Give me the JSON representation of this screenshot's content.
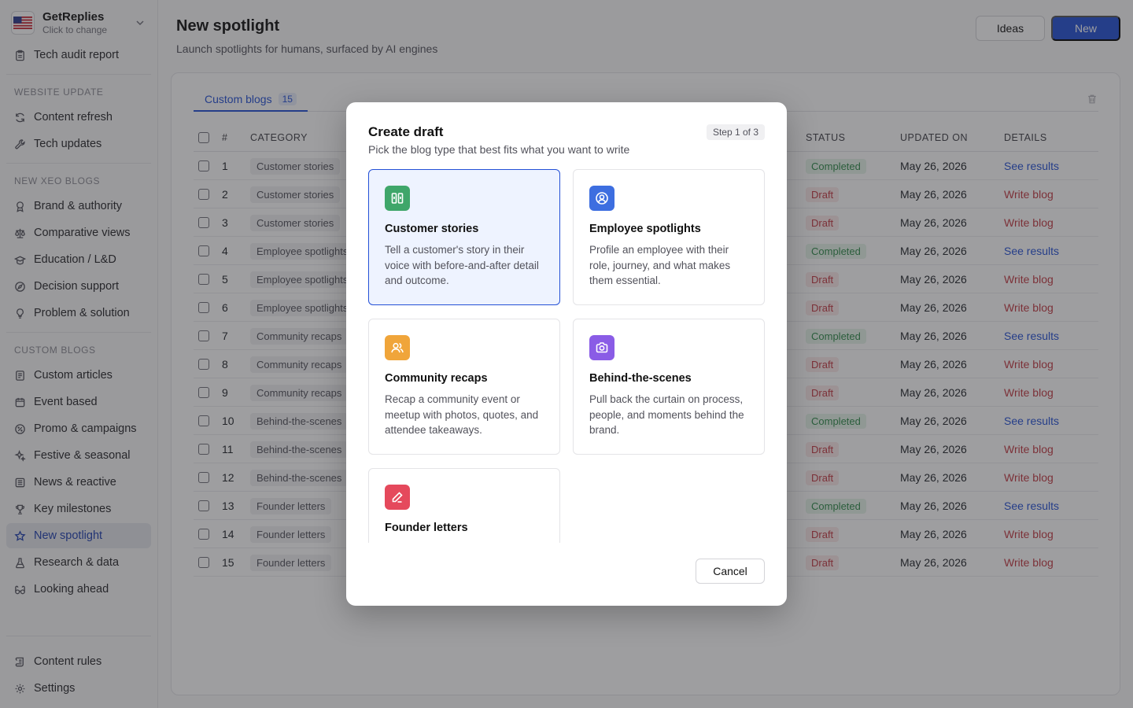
{
  "brand": {
    "name": "GetReplies",
    "sub": "Click to change"
  },
  "sidebar": {
    "top_items": [
      {
        "label": "Tech audit report",
        "icon": "clipboard-icon"
      }
    ],
    "sections": [
      {
        "title": "WEBSITE UPDATE",
        "items": [
          {
            "label": "Content refresh",
            "icon": "refresh-icon"
          },
          {
            "label": "Tech updates",
            "icon": "wrench-icon"
          }
        ]
      },
      {
        "title": "NEW XEO BLOGS",
        "items": [
          {
            "label": "Brand & authority",
            "icon": "award-icon"
          },
          {
            "label": "Comparative views",
            "icon": "scale-icon"
          },
          {
            "label": "Education / L&D",
            "icon": "graduation-cap-icon"
          },
          {
            "label": "Decision support",
            "icon": "compass-icon"
          },
          {
            "label": "Problem & solution",
            "icon": "lightbulb-icon"
          }
        ]
      },
      {
        "title": "CUSTOM BLOGS",
        "items": [
          {
            "label": "Custom articles",
            "icon": "file-text-icon"
          },
          {
            "label": "Event based",
            "icon": "calendar-icon"
          },
          {
            "label": "Promo & campaigns",
            "icon": "percent-badge-icon"
          },
          {
            "label": "Festive & seasonal",
            "icon": "sparkles-icon"
          },
          {
            "label": "News & reactive",
            "icon": "newspaper-icon"
          },
          {
            "label": "Key milestones",
            "icon": "trophy-icon"
          },
          {
            "label": "New spotlight",
            "icon": "star-icon",
            "active": true
          },
          {
            "label": "Research & data",
            "icon": "flask-icon"
          },
          {
            "label": "Looking ahead",
            "icon": "binoculars-icon"
          }
        ]
      }
    ],
    "bottom_items": [
      {
        "label": "Content rules",
        "icon": "scroll-icon"
      },
      {
        "label": "Settings",
        "icon": "gear-icon"
      }
    ]
  },
  "header": {
    "title": "New spotlight",
    "subtitle": "Launch spotlights for humans, surfaced by AI engines",
    "ideas_label": "Ideas",
    "new_label": "New"
  },
  "tabs": [
    {
      "label": "Custom blogs",
      "count": "15"
    }
  ],
  "table": {
    "headers": {
      "num": "#",
      "category": "CATEGORY",
      "status": "STATUS",
      "updated": "UPDATED ON",
      "details": "DETAILS"
    },
    "rows": [
      {
        "num": "1",
        "category": "Customer stories",
        "status": "Completed",
        "updated": "May 26, 2026",
        "details": "See results"
      },
      {
        "num": "2",
        "category": "Customer stories",
        "status": "Draft",
        "updated": "May 26, 2026",
        "details": "Write blog"
      },
      {
        "num": "3",
        "category": "Customer stories",
        "status": "Draft",
        "updated": "May 26, 2026",
        "details": "Write blog"
      },
      {
        "num": "4",
        "category": "Employee spotlights",
        "status": "Completed",
        "updated": "May 26, 2026",
        "details": "See results"
      },
      {
        "num": "5",
        "category": "Employee spotlights",
        "status": "Draft",
        "updated": "May 26, 2026",
        "details": "Write blog"
      },
      {
        "num": "6",
        "category": "Employee spotlights",
        "status": "Draft",
        "updated": "May 26, 2026",
        "details": "Write blog"
      },
      {
        "num": "7",
        "category": "Community recaps",
        "status": "Completed",
        "updated": "May 26, 2026",
        "details": "See results"
      },
      {
        "num": "8",
        "category": "Community recaps",
        "status": "Draft",
        "updated": "May 26, 2026",
        "details": "Write blog"
      },
      {
        "num": "9",
        "category": "Community recaps",
        "status": "Draft",
        "updated": "May 26, 2026",
        "details": "Write blog"
      },
      {
        "num": "10",
        "category": "Behind-the-scenes",
        "status": "Completed",
        "updated": "May 26, 2026",
        "details": "See results"
      },
      {
        "num": "11",
        "category": "Behind-the-scenes",
        "status": "Draft",
        "updated": "May 26, 2026",
        "details": "Write blog"
      },
      {
        "num": "12",
        "category": "Behind-the-scenes",
        "status": "Draft",
        "updated": "May 26, 2026",
        "details": "Write blog"
      },
      {
        "num": "13",
        "category": "Founder letters",
        "status": "Completed",
        "updated": "May 26, 2026",
        "details": "See results"
      },
      {
        "num": "14",
        "category": "Founder letters",
        "status": "Draft",
        "updated": "May 26, 2026",
        "details": "Write blog"
      },
      {
        "num": "15",
        "category": "Founder letters",
        "status": "Draft",
        "updated": "May 26, 2026",
        "details": "Write blog"
      }
    ]
  },
  "modal": {
    "title": "Create draft",
    "subtitle": "Pick the blog type that best fits what you want to write",
    "step": "Step 1 of 3",
    "options": [
      {
        "title": "Customer stories",
        "desc": "Tell a customer's story in their voice with before-and-after detail and outcome.",
        "icon": "quote-icon",
        "color": "#3fa66a",
        "selected": true
      },
      {
        "title": "Employee spotlights",
        "desc": "Profile an employee with their role, journey, and what makes them essential.",
        "icon": "user-circle-icon",
        "color": "#3d6ee0",
        "selected": false
      },
      {
        "title": "Community recaps",
        "desc": "Recap a community event or meetup with photos, quotes, and attendee takeaways.",
        "icon": "users-icon",
        "color": "#f0a53a",
        "selected": false
      },
      {
        "title": "Behind-the-scenes",
        "desc": "Pull back the curtain on process, people, and moments behind the brand.",
        "icon": "camera-icon",
        "color": "#8a5ce6",
        "selected": false
      },
      {
        "title": "Founder letters",
        "desc": "",
        "icon": "pen-icon",
        "color": "#e5495c",
        "selected": false
      }
    ],
    "cancel_label": "Cancel"
  }
}
